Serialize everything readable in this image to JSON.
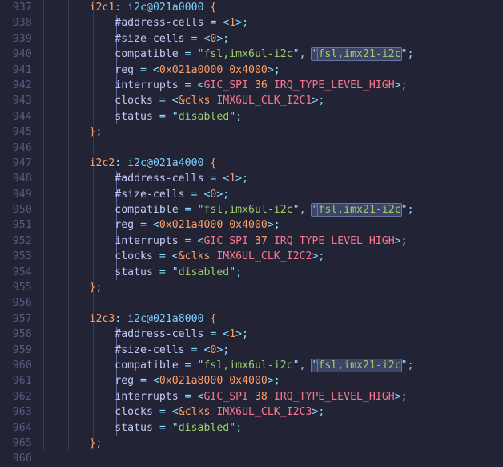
{
  "editor": {
    "language": "devicetree",
    "theme": "tokyo-night-moon",
    "first_line": 937,
    "last_line": 966,
    "colors": {
      "background": "#222436",
      "line_number": "#545c7e",
      "indent_guide": "#343b58",
      "indent_guide_active": "#5d6697",
      "match_highlight_bg": "#3d4466",
      "match_highlight_border": "#6b74a8",
      "label": "#ff9e64",
      "node_name": "#7dcfff",
      "property": "#c0caf5",
      "string": "#9ece6a",
      "number": "#ff9e64",
      "macro": "#f7768e",
      "punctuation": "#89ddff"
    },
    "search_match_text": "fsl,imx21-i2c",
    "search_match_lines": [
      940,
      950,
      960
    ]
  },
  "lines": [
    {
      "n": "937",
      "indent": 2,
      "tokens": [
        {
          "t": "i2c1",
          "c": "t-label"
        },
        {
          "t": ": ",
          "c": "t-punc"
        },
        {
          "t": "i2c@021a0000",
          "c": "t-node"
        },
        {
          "t": " ",
          "c": "t-prop"
        },
        {
          "t": "{",
          "c": "t-brace"
        }
      ]
    },
    {
      "n": "938",
      "indent": 3,
      "tokens": [
        {
          "t": "#address-cells ",
          "c": "t-prop"
        },
        {
          "t": "= <",
          "c": "t-punc"
        },
        {
          "t": "1",
          "c": "t-num"
        },
        {
          "t": ">;",
          "c": "t-punc"
        }
      ]
    },
    {
      "n": "939",
      "indent": 3,
      "tokens": [
        {
          "t": "#size-cells ",
          "c": "t-prop"
        },
        {
          "t": "= <",
          "c": "t-punc"
        },
        {
          "t": "0",
          "c": "t-num"
        },
        {
          "t": ">;",
          "c": "t-punc"
        }
      ]
    },
    {
      "n": "940",
      "indent": 3,
      "tokens": [
        {
          "t": "compatible ",
          "c": "t-prop"
        },
        {
          "t": "= ",
          "c": "t-punc"
        },
        {
          "t": "\"",
          "c": "t-punc"
        },
        {
          "t": "fsl,imx6ul-i2c",
          "c": "t-str"
        },
        {
          "t": "\"",
          "c": "t-punc"
        },
        {
          "t": ", ",
          "c": "t-punc"
        },
        {
          "t": "\"",
          "c": "t-punc",
          "m": true
        },
        {
          "t": "fsl,imx21-i2c",
          "c": "t-str",
          "m": true
        },
        {
          "t": "\"",
          "c": "t-punc"
        },
        {
          "t": ";",
          "c": "t-punc"
        }
      ]
    },
    {
      "n": "941",
      "indent": 3,
      "tokens": [
        {
          "t": "reg ",
          "c": "t-prop"
        },
        {
          "t": "= <",
          "c": "t-punc"
        },
        {
          "t": "0x021a0000 0x4000",
          "c": "t-num"
        },
        {
          "t": ">;",
          "c": "t-punc"
        }
      ]
    },
    {
      "n": "942",
      "indent": 3,
      "tokens": [
        {
          "t": "interrupts ",
          "c": "t-prop"
        },
        {
          "t": "= <",
          "c": "t-punc"
        },
        {
          "t": "GIC_SPI",
          "c": "t-macro"
        },
        {
          "t": " ",
          "c": "t-prop"
        },
        {
          "t": "36",
          "c": "t-num"
        },
        {
          "t": " ",
          "c": "t-prop"
        },
        {
          "t": "IRQ_TYPE_LEVEL_HIGH",
          "c": "t-macro"
        },
        {
          "t": ">;",
          "c": "t-punc"
        }
      ]
    },
    {
      "n": "943",
      "indent": 3,
      "tokens": [
        {
          "t": "clocks ",
          "c": "t-prop"
        },
        {
          "t": "= <",
          "c": "t-punc"
        },
        {
          "t": "&clks",
          "c": "t-ref"
        },
        {
          "t": " ",
          "c": "t-prop"
        },
        {
          "t": "IMX6UL_CLK_I2C1",
          "c": "t-macro"
        },
        {
          "t": ">;",
          "c": "t-punc"
        }
      ]
    },
    {
      "n": "944",
      "indent": 3,
      "tokens": [
        {
          "t": "status ",
          "c": "t-prop"
        },
        {
          "t": "= ",
          "c": "t-punc"
        },
        {
          "t": "\"",
          "c": "t-punc"
        },
        {
          "t": "disabled",
          "c": "t-str"
        },
        {
          "t": "\"",
          "c": "t-punc"
        },
        {
          "t": ";",
          "c": "t-punc"
        }
      ]
    },
    {
      "n": "945",
      "indent": 2,
      "tokens": [
        {
          "t": "}",
          "c": "t-brace"
        },
        {
          "t": ";",
          "c": "t-punc"
        }
      ]
    },
    {
      "n": "946",
      "indent": 0,
      "tokens": []
    },
    {
      "n": "947",
      "indent": 2,
      "tokens": [
        {
          "t": "i2c2",
          "c": "t-label"
        },
        {
          "t": ": ",
          "c": "t-punc"
        },
        {
          "t": "i2c@021a4000",
          "c": "t-node"
        },
        {
          "t": " ",
          "c": "t-prop"
        },
        {
          "t": "{",
          "c": "t-brace"
        }
      ]
    },
    {
      "n": "948",
      "indent": 3,
      "tokens": [
        {
          "t": "#address-cells ",
          "c": "t-prop"
        },
        {
          "t": "= <",
          "c": "t-punc"
        },
        {
          "t": "1",
          "c": "t-num"
        },
        {
          "t": ">;",
          "c": "t-punc"
        }
      ]
    },
    {
      "n": "949",
      "indent": 3,
      "tokens": [
        {
          "t": "#size-cells ",
          "c": "t-prop"
        },
        {
          "t": "= <",
          "c": "t-punc"
        },
        {
          "t": "0",
          "c": "t-num"
        },
        {
          "t": ">;",
          "c": "t-punc"
        }
      ]
    },
    {
      "n": "950",
      "indent": 3,
      "tokens": [
        {
          "t": "compatible ",
          "c": "t-prop"
        },
        {
          "t": "= ",
          "c": "t-punc"
        },
        {
          "t": "\"",
          "c": "t-punc"
        },
        {
          "t": "fsl,imx6ul-i2c",
          "c": "t-str"
        },
        {
          "t": "\"",
          "c": "t-punc"
        },
        {
          "t": ", ",
          "c": "t-punc"
        },
        {
          "t": "\"",
          "c": "t-punc",
          "m": true
        },
        {
          "t": "fsl,imx21-i2c",
          "c": "t-str",
          "m": true
        },
        {
          "t": "\"",
          "c": "t-punc"
        },
        {
          "t": ";",
          "c": "t-punc"
        }
      ]
    },
    {
      "n": "951",
      "indent": 3,
      "tokens": [
        {
          "t": "reg ",
          "c": "t-prop"
        },
        {
          "t": "= <",
          "c": "t-punc"
        },
        {
          "t": "0x021a4000 0x4000",
          "c": "t-num"
        },
        {
          "t": ">;",
          "c": "t-punc"
        }
      ]
    },
    {
      "n": "952",
      "indent": 3,
      "tokens": [
        {
          "t": "interrupts ",
          "c": "t-prop"
        },
        {
          "t": "= <",
          "c": "t-punc"
        },
        {
          "t": "GIC_SPI",
          "c": "t-macro"
        },
        {
          "t": " ",
          "c": "t-prop"
        },
        {
          "t": "37",
          "c": "t-num"
        },
        {
          "t": " ",
          "c": "t-prop"
        },
        {
          "t": "IRQ_TYPE_LEVEL_HIGH",
          "c": "t-macro"
        },
        {
          "t": ">;",
          "c": "t-punc"
        }
      ]
    },
    {
      "n": "953",
      "indent": 3,
      "tokens": [
        {
          "t": "clocks ",
          "c": "t-prop"
        },
        {
          "t": "= <",
          "c": "t-punc"
        },
        {
          "t": "&clks",
          "c": "t-ref"
        },
        {
          "t": " ",
          "c": "t-prop"
        },
        {
          "t": "IMX6UL_CLK_I2C2",
          "c": "t-macro"
        },
        {
          "t": ">;",
          "c": "t-punc"
        }
      ]
    },
    {
      "n": "954",
      "indent": 3,
      "tokens": [
        {
          "t": "status ",
          "c": "t-prop"
        },
        {
          "t": "= ",
          "c": "t-punc"
        },
        {
          "t": "\"",
          "c": "t-punc"
        },
        {
          "t": "disabled",
          "c": "t-str"
        },
        {
          "t": "\"",
          "c": "t-punc"
        },
        {
          "t": ";",
          "c": "t-punc"
        }
      ]
    },
    {
      "n": "955",
      "indent": 2,
      "tokens": [
        {
          "t": "}",
          "c": "t-brace"
        },
        {
          "t": ";",
          "c": "t-punc"
        }
      ]
    },
    {
      "n": "956",
      "indent": 0,
      "tokens": []
    },
    {
      "n": "957",
      "indent": 2,
      "tokens": [
        {
          "t": "i2c3",
          "c": "t-label"
        },
        {
          "t": ": ",
          "c": "t-punc"
        },
        {
          "t": "i2c@021a8000",
          "c": "t-node"
        },
        {
          "t": " ",
          "c": "t-prop"
        },
        {
          "t": "{",
          "c": "t-brace"
        }
      ]
    },
    {
      "n": "958",
      "indent": 3,
      "tokens": [
        {
          "t": "#address-cells ",
          "c": "t-prop"
        },
        {
          "t": "= <",
          "c": "t-punc"
        },
        {
          "t": "1",
          "c": "t-num"
        },
        {
          "t": ">;",
          "c": "t-punc"
        }
      ]
    },
    {
      "n": "959",
      "indent": 3,
      "tokens": [
        {
          "t": "#size-cells ",
          "c": "t-prop"
        },
        {
          "t": "= <",
          "c": "t-punc"
        },
        {
          "t": "0",
          "c": "t-num"
        },
        {
          "t": ">;",
          "c": "t-punc"
        }
      ]
    },
    {
      "n": "960",
      "indent": 3,
      "tokens": [
        {
          "t": "compatible ",
          "c": "t-prop"
        },
        {
          "t": "= ",
          "c": "t-punc"
        },
        {
          "t": "\"",
          "c": "t-punc"
        },
        {
          "t": "fsl,imx6ul-i2c",
          "c": "t-str"
        },
        {
          "t": "\"",
          "c": "t-punc"
        },
        {
          "t": ", ",
          "c": "t-punc"
        },
        {
          "t": "\"",
          "c": "t-punc",
          "m": true
        },
        {
          "t": "fsl,imx21-i2c",
          "c": "t-str",
          "m": true
        },
        {
          "t": "\"",
          "c": "t-punc"
        },
        {
          "t": ";",
          "c": "t-punc"
        }
      ]
    },
    {
      "n": "961",
      "indent": 3,
      "tokens": [
        {
          "t": "reg ",
          "c": "t-prop"
        },
        {
          "t": "= <",
          "c": "t-punc"
        },
        {
          "t": "0x021a8000 0x4000",
          "c": "t-num"
        },
        {
          "t": ">;",
          "c": "t-punc"
        }
      ]
    },
    {
      "n": "962",
      "indent": 3,
      "tokens": [
        {
          "t": "interrupts ",
          "c": "t-prop"
        },
        {
          "t": "= <",
          "c": "t-punc"
        },
        {
          "t": "GIC_SPI",
          "c": "t-macro"
        },
        {
          "t": " ",
          "c": "t-prop"
        },
        {
          "t": "38",
          "c": "t-num"
        },
        {
          "t": " ",
          "c": "t-prop"
        },
        {
          "t": "IRQ_TYPE_LEVEL_HIGH",
          "c": "t-macro"
        },
        {
          "t": ">;",
          "c": "t-punc"
        }
      ]
    },
    {
      "n": "963",
      "indent": 3,
      "tokens": [
        {
          "t": "clocks ",
          "c": "t-prop"
        },
        {
          "t": "= <",
          "c": "t-punc"
        },
        {
          "t": "&clks",
          "c": "t-ref"
        },
        {
          "t": " ",
          "c": "t-prop"
        },
        {
          "t": "IMX6UL_CLK_I2C3",
          "c": "t-macro"
        },
        {
          "t": ">;",
          "c": "t-punc"
        }
      ]
    },
    {
      "n": "964",
      "indent": 3,
      "tokens": [
        {
          "t": "status ",
          "c": "t-prop"
        },
        {
          "t": "= ",
          "c": "t-punc"
        },
        {
          "t": "\"",
          "c": "t-punc"
        },
        {
          "t": "disabled",
          "c": "t-str"
        },
        {
          "t": "\"",
          "c": "t-punc"
        },
        {
          "t": ";",
          "c": "t-punc"
        }
      ]
    },
    {
      "n": "965",
      "indent": 2,
      "tokens": [
        {
          "t": "}",
          "c": "t-brace"
        },
        {
          "t": ";",
          "c": "t-punc"
        }
      ]
    },
    {
      "n": "966",
      "indent": 0,
      "tokens": []
    }
  ]
}
